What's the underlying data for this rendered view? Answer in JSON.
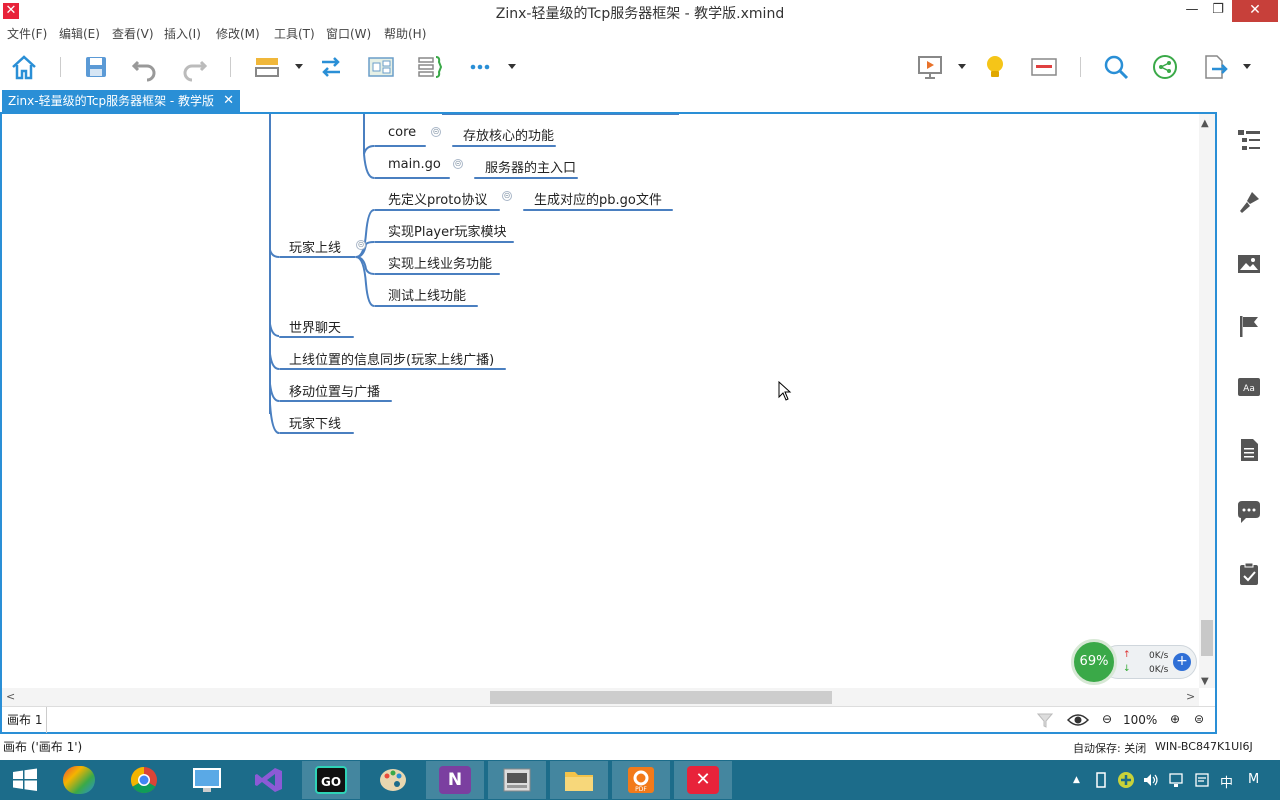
{
  "window": {
    "title": "Zinx-轻量级的Tcp服务器框架 - 教学版.xmind",
    "app_icon_glyph": "✕",
    "min_glyph": "—",
    "max_glyph": "❐",
    "close_glyph": "✕"
  },
  "menu": {
    "file": "文件(F)",
    "edit": "编辑(E)",
    "view": "查看(V)",
    "insert": "插入(I)",
    "modify": "修改(M)",
    "tools": "工具(T)",
    "window": "窗口(W)",
    "help": "帮助(H)"
  },
  "tab": {
    "label": "Zinx-轻量级的Tcp服务器框架 - 教学版",
    "close_glyph": "✕"
  },
  "mindmap": {
    "level1": [
      {
        "label": "玩家上线"
      },
      {
        "label": "世界聊天"
      },
      {
        "label": "上线位置的信息同步(玩家上线广播)"
      },
      {
        "label": "移动位置与广播"
      },
      {
        "label": "玩家下线"
      }
    ],
    "upper_children": [
      {
        "label": "core",
        "note": "存放核心的功能"
      },
      {
        "label": "main.go",
        "note": "服务器的主入口"
      }
    ],
    "online_children": [
      {
        "label": "先定义proto协议",
        "note": "生成对应的pb.go文件"
      },
      {
        "label": "实现Player玩家模块"
      },
      {
        "label": "实现上线业务功能"
      },
      {
        "label": "测试上线功能"
      }
    ],
    "collapse_glyph": "⊝"
  },
  "scroll": {
    "up": "▲",
    "down": "▼",
    "left": "<",
    "right": ">"
  },
  "sheetbar": {
    "sheet_label": "画布 1",
    "zoom": "100%",
    "zoom_out": "⊖",
    "zoom_in": "⊕",
    "fit": "⊜"
  },
  "netmon": {
    "percent": "69%",
    "up_rate": "0K/s",
    "down_rate": "0K/s",
    "up_arrow": "↑",
    "down_arrow": "↓",
    "plus": "+"
  },
  "status": {
    "left": "画布 ('画布 1')",
    "autosave": "自动保存: 关闭",
    "host": "WIN-BC847K1UI6J"
  },
  "tray": {
    "up_caret": "▲",
    "ime": "中",
    "ime_mode": "M"
  },
  "colors": {
    "accent": "#2a8fd6",
    "branch": "#4a7fc0",
    "taskbar": "#1c6c8a",
    "close": "#c7403a"
  },
  "icons": {
    "toolbar": [
      "home-icon",
      "save-icon",
      "undo-icon",
      "redo-icon",
      "topic-icon",
      "relationship-icon",
      "boundary-icon",
      "summary-icon",
      "more-icon",
      "presentation-icon",
      "idea-icon",
      "format-panel-icon",
      "search-icon",
      "share-icon",
      "export-icon"
    ],
    "sidebar": [
      "outline-icon",
      "format-icon",
      "image-icon",
      "marker-icon",
      "text-style-icon",
      "notes-icon",
      "comments-icon",
      "task-icon"
    ]
  }
}
